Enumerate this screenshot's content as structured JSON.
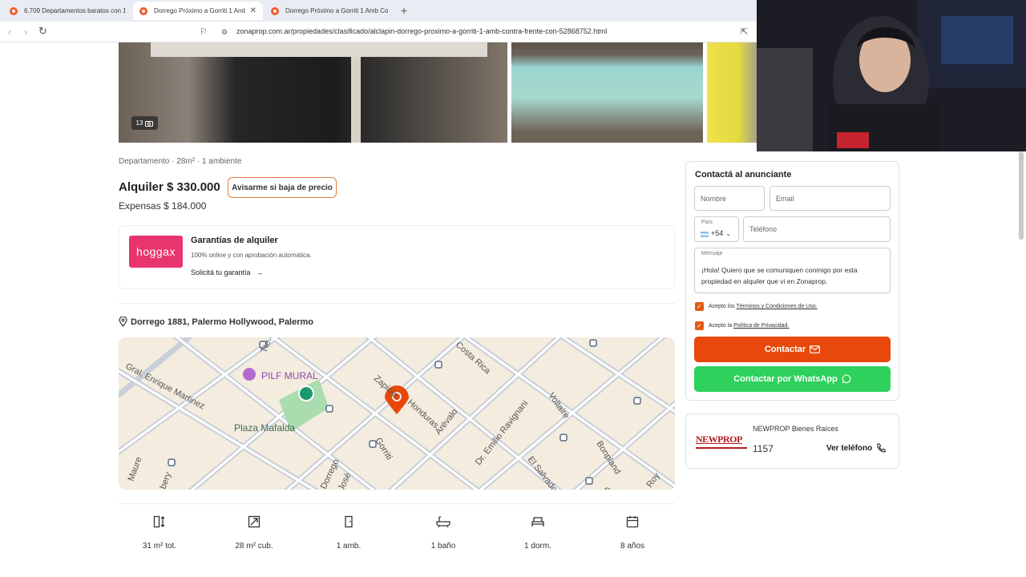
{
  "browser": {
    "tabs": [
      {
        "title": "6.709 Departamentos baratos con 1"
      },
      {
        "title": "Dorrego Próximo a Gorriti 1 Amb"
      },
      {
        "title": "Dorrego Próximo a Gorriti 1 Amb Co"
      }
    ],
    "close_glyph": "✕",
    "new_tab_glyph": "+",
    "url": "zonaprop.com.ar/propiedades/clasificado/alclapin-dorrego-proximo-a-gorriti-1-amb-contra-frente-con-52868752.html"
  },
  "gallery": {
    "photo_count": "13"
  },
  "listing": {
    "meta": "Departamento · 28m² · 1 ambiente",
    "price": "Alquiler $ 330.000",
    "price_alert_label": "Avisarme si baja de precio",
    "expensas": "Expensas $ 184.000"
  },
  "guarantee": {
    "logo_text": "hoggax",
    "title": "Garantías de alquiler",
    "subtitle": "100% online y con aprobación automática.",
    "link_label": "Solicitá tu garantía"
  },
  "location": {
    "address": "Dorrego 1881, Palermo Hollywood, Palermo"
  },
  "map": {
    "labels": [
      {
        "text": "PILF MURAL"
      },
      {
        "text": "Plaza Mafalda"
      },
      {
        "text": "Gral. Enrique Martinez"
      },
      {
        "text": "Zapiola"
      },
      {
        "text": "Honduras"
      },
      {
        "text": "Arévalo"
      },
      {
        "text": "Costa Rica"
      },
      {
        "text": "Dr. Emilio Ravignani"
      },
      {
        "text": "Voltaire"
      },
      {
        "text": "Gorriti"
      },
      {
        "text": "El Salvador"
      },
      {
        "text": "Bonpland"
      },
      {
        "text": "Maure"
      },
      {
        "text": "Dorrego"
      },
      {
        "text": "José"
      },
      {
        "text": "Tte."
      },
      {
        "text": "Roy"
      },
      {
        "text": "Co"
      },
      {
        "text": "bery"
      }
    ]
  },
  "features": [
    {
      "label": "31 m² tot.",
      "icon": "total-area-icon"
    },
    {
      "label": "28 m² cub.",
      "icon": "covered-area-icon"
    },
    {
      "label": "1 amb.",
      "icon": "door-icon"
    },
    {
      "label": "1 baño",
      "icon": "bathtub-icon"
    },
    {
      "label": "1 dorm.",
      "icon": "bed-icon"
    },
    {
      "label": "8 años",
      "icon": "calendar-icon"
    }
  ],
  "contact": {
    "title": "Contactá al anunciante",
    "name_placeholder": "Nombre",
    "email_placeholder": "Email",
    "country_label": "País",
    "country_code": "+54",
    "phone_placeholder": "Teléfono",
    "message_label": "Mensaje",
    "message": "¡Hola! Quiero que se comuniquen conmigo por esta propiedad en alquiler que vi en Zonaprop.",
    "terms_prefix": "Acepto los",
    "terms_link": "Términos y Condiciones de Uso.",
    "privacy_prefix": "Acepto la",
    "privacy_link": "Política de Privacidad.",
    "contact_button": "Contactar",
    "whatsapp_button": "Contactar por WhatsApp"
  },
  "agency": {
    "logo_text": "NEWPROP",
    "name": "NEWPROP Bienes Raíces",
    "phone_partial": "1157",
    "show_phone": "Ver teléfono"
  },
  "colors": {
    "accent": "#e8480c",
    "whatsapp": "#2ed15c",
    "hoggax": "#e8356d"
  }
}
